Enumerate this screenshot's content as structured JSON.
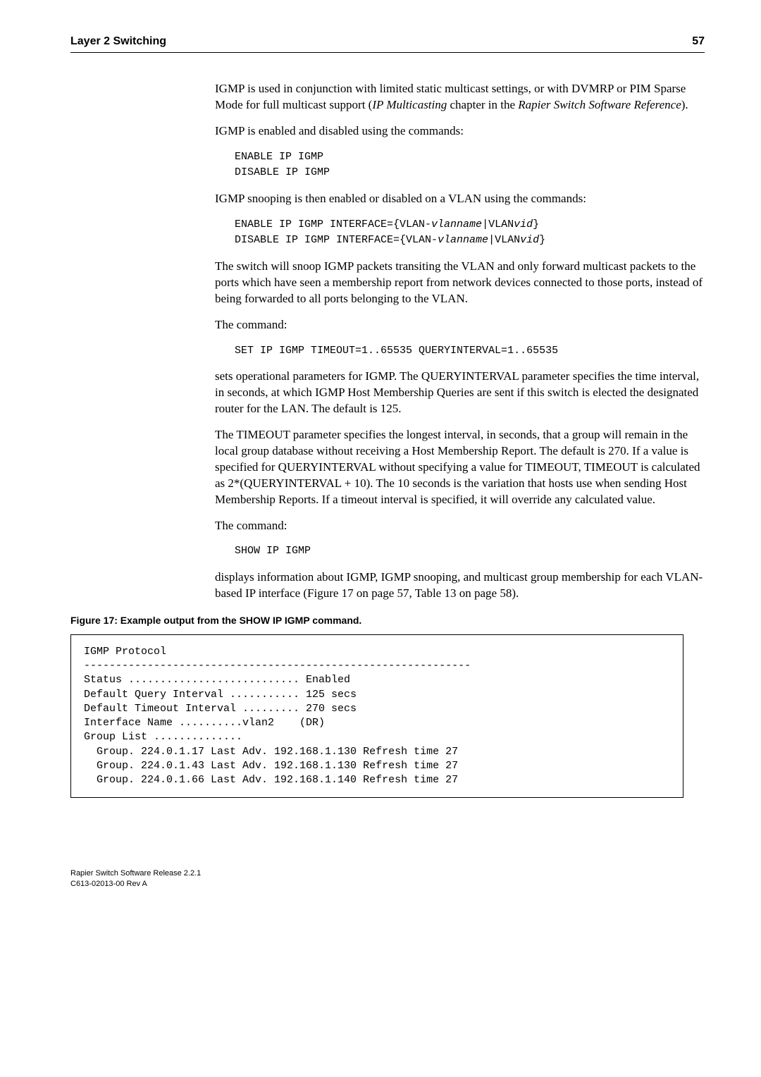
{
  "header": {
    "section": "Layer 2 Switching",
    "page": "57"
  },
  "paragraphs": {
    "p1_pre": "IGMP is used in conjunction with limited static multicast settings, or with DVMRP or PIM Sparse Mode for full multicast support (",
    "p1_it1": "IP Multicasting",
    "p1_mid": " chapter in the ",
    "p1_it2": "Rapier Switch Software Reference",
    "p1_post": ").",
    "p2": "IGMP is enabled and disabled using the commands:",
    "code1": "ENABLE IP IGMP\nDISABLE IP IGMP",
    "p3": "IGMP snooping is then enabled or disabled on a VLAN using the commands:",
    "code2a_pre": "ENABLE IP IGMP INTERFACE={VLAN-",
    "code2a_it1": "vlanname",
    "code2a_mid": "|VLAN",
    "code2a_it2": "vid",
    "code2a_post": "}",
    "code2b_pre": "DISABLE IP IGMP INTERFACE={VLAN-",
    "code2b_it1": "vlanname",
    "code2b_mid": "|VLAN",
    "code2b_it2": "vid",
    "code2b_post": "}",
    "p4": "The switch will snoop IGMP packets transiting the VLAN and only forward multicast packets to the ports which have seen a membership report from network devices connected to those ports, instead of being forwarded to all ports belonging to the VLAN.",
    "p5": "The command:",
    "code3": "SET IP IGMP TIMEOUT=1..65535 QUERYINTERVAL=1..65535",
    "p6": "sets operational parameters for IGMP. The QUERYINTERVAL parameter specifies the time interval, in seconds, at which IGMP Host Membership Queries are sent if this switch is elected the designated router for the LAN. The default is 125.",
    "p7": "The TIMEOUT parameter specifies the longest interval, in seconds, that a group will remain in the local group database without receiving a Host Membership Report. The default is 270. If a value is specified for QUERYINTERVAL without specifying a value for TIMEOUT, TIMEOUT is calculated as 2*(QUERYINTERVAL + 10). The 10 seconds is the variation that hosts use when sending Host Membership Reports. If a timeout interval is specified, it will override any calculated value.",
    "p8": "The command:",
    "code4": "SHOW IP IGMP",
    "p9": "displays information about IGMP, IGMP snooping, and multicast group membership for each VLAN-based IP interface (Figure 17 on page 57, Table 13 on page 58)."
  },
  "figure": {
    "caption": "Figure 17: Example output from the SHOW IP IGMP command.",
    "text": "IGMP Protocol\n-------------------------------------------------------------\nStatus ........................... Enabled\nDefault Query Interval ........... 125 secs\nDefault Timeout Interval ......... 270 secs\nInterface Name ..........vlan2    (DR)\nGroup List ..............\n  Group. 224.0.1.17 Last Adv. 192.168.1.130 Refresh time 27\n  Group. 224.0.1.43 Last Adv. 192.168.1.130 Refresh time 27\n  Group. 224.0.1.66 Last Adv. 192.168.1.140 Refresh time 27"
  },
  "footer": {
    "line1": "Rapier Switch Software Release 2.2.1",
    "line2": "C613-02013-00 Rev A"
  }
}
